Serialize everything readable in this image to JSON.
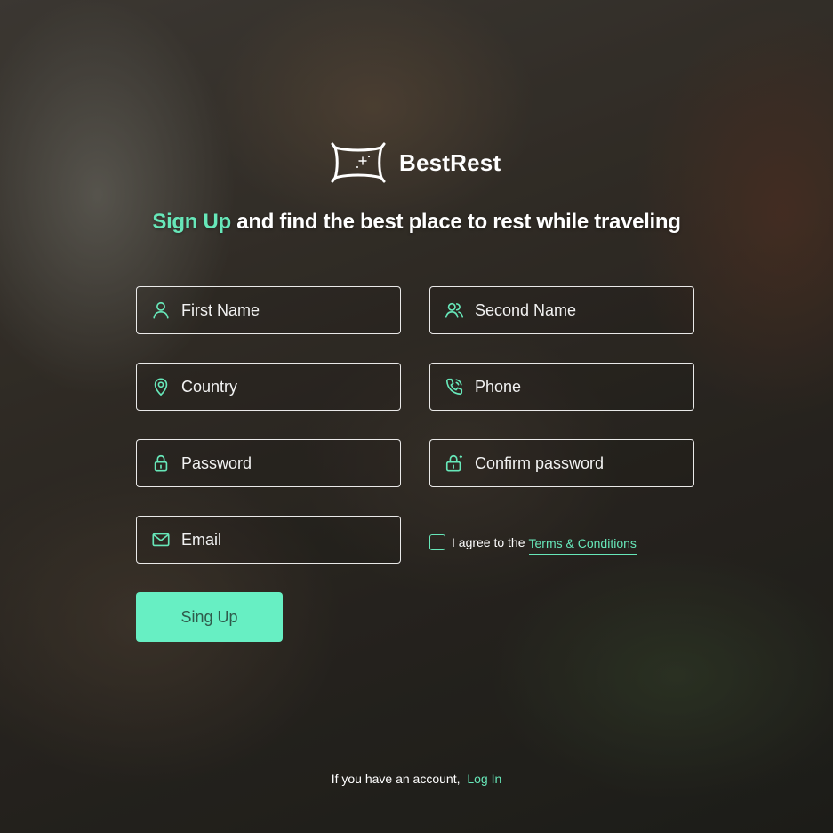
{
  "brand": {
    "name": "BestRest",
    "logo_icon": "pillow-icon"
  },
  "headline": {
    "accent": "Sign Up",
    "rest": "and find the best place to rest while traveling"
  },
  "form": {
    "fields": {
      "first_name": {
        "placeholder": "First Name",
        "value": "",
        "icon": "user-icon"
      },
      "second_name": {
        "placeholder": "Second Name",
        "value": "",
        "icon": "users-icon"
      },
      "country": {
        "placeholder": "Country",
        "value": "",
        "icon": "location-pin-icon"
      },
      "phone": {
        "placeholder": "Phone",
        "value": "",
        "icon": "phone-icon"
      },
      "password": {
        "placeholder": "Password",
        "value": "",
        "icon": "lock-icon"
      },
      "confirm_password": {
        "placeholder": "Confirm password",
        "value": "",
        "icon": "unlock-icon"
      },
      "email": {
        "placeholder": "Email",
        "value": "",
        "icon": "mail-icon"
      }
    },
    "agree": {
      "checked": false,
      "text": "I agree to the",
      "link_label": "Terms & Conditions"
    },
    "submit_label": "Sing Up"
  },
  "footer": {
    "text": "If you have an account,",
    "link_label": "Log In"
  },
  "colors": {
    "accent": "#67e7b9",
    "button_bg": "#67efc3",
    "button_text": "#2f5a4b",
    "text": "#ffffff"
  }
}
